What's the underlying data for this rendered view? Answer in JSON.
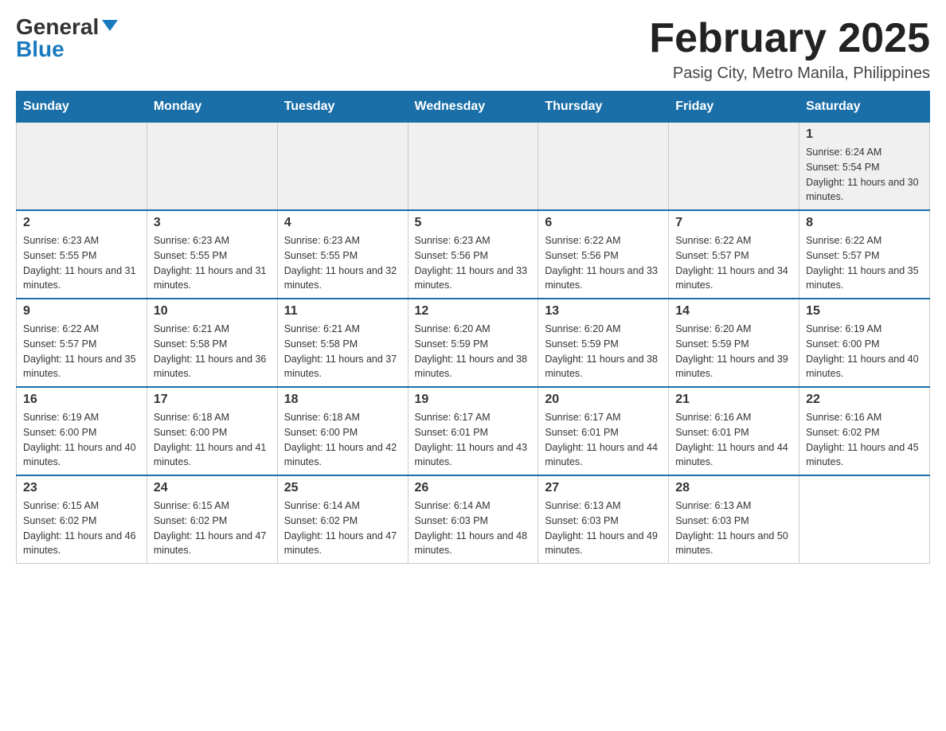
{
  "header": {
    "logo_general": "General",
    "logo_blue": "Blue",
    "month_title": "February 2025",
    "location": "Pasig City, Metro Manila, Philippines"
  },
  "days_of_week": [
    "Sunday",
    "Monday",
    "Tuesday",
    "Wednesday",
    "Thursday",
    "Friday",
    "Saturday"
  ],
  "weeks": [
    [
      {
        "day": "",
        "info": ""
      },
      {
        "day": "",
        "info": ""
      },
      {
        "day": "",
        "info": ""
      },
      {
        "day": "",
        "info": ""
      },
      {
        "day": "",
        "info": ""
      },
      {
        "day": "",
        "info": ""
      },
      {
        "day": "1",
        "info": "Sunrise: 6:24 AM\nSunset: 5:54 PM\nDaylight: 11 hours and 30 minutes."
      }
    ],
    [
      {
        "day": "2",
        "info": "Sunrise: 6:23 AM\nSunset: 5:55 PM\nDaylight: 11 hours and 31 minutes."
      },
      {
        "day": "3",
        "info": "Sunrise: 6:23 AM\nSunset: 5:55 PM\nDaylight: 11 hours and 31 minutes."
      },
      {
        "day": "4",
        "info": "Sunrise: 6:23 AM\nSunset: 5:55 PM\nDaylight: 11 hours and 32 minutes."
      },
      {
        "day": "5",
        "info": "Sunrise: 6:23 AM\nSunset: 5:56 PM\nDaylight: 11 hours and 33 minutes."
      },
      {
        "day": "6",
        "info": "Sunrise: 6:22 AM\nSunset: 5:56 PM\nDaylight: 11 hours and 33 minutes."
      },
      {
        "day": "7",
        "info": "Sunrise: 6:22 AM\nSunset: 5:57 PM\nDaylight: 11 hours and 34 minutes."
      },
      {
        "day": "8",
        "info": "Sunrise: 6:22 AM\nSunset: 5:57 PM\nDaylight: 11 hours and 35 minutes."
      }
    ],
    [
      {
        "day": "9",
        "info": "Sunrise: 6:22 AM\nSunset: 5:57 PM\nDaylight: 11 hours and 35 minutes."
      },
      {
        "day": "10",
        "info": "Sunrise: 6:21 AM\nSunset: 5:58 PM\nDaylight: 11 hours and 36 minutes."
      },
      {
        "day": "11",
        "info": "Sunrise: 6:21 AM\nSunset: 5:58 PM\nDaylight: 11 hours and 37 minutes."
      },
      {
        "day": "12",
        "info": "Sunrise: 6:20 AM\nSunset: 5:59 PM\nDaylight: 11 hours and 38 minutes."
      },
      {
        "day": "13",
        "info": "Sunrise: 6:20 AM\nSunset: 5:59 PM\nDaylight: 11 hours and 38 minutes."
      },
      {
        "day": "14",
        "info": "Sunrise: 6:20 AM\nSunset: 5:59 PM\nDaylight: 11 hours and 39 minutes."
      },
      {
        "day": "15",
        "info": "Sunrise: 6:19 AM\nSunset: 6:00 PM\nDaylight: 11 hours and 40 minutes."
      }
    ],
    [
      {
        "day": "16",
        "info": "Sunrise: 6:19 AM\nSunset: 6:00 PM\nDaylight: 11 hours and 40 minutes."
      },
      {
        "day": "17",
        "info": "Sunrise: 6:18 AM\nSunset: 6:00 PM\nDaylight: 11 hours and 41 minutes."
      },
      {
        "day": "18",
        "info": "Sunrise: 6:18 AM\nSunset: 6:00 PM\nDaylight: 11 hours and 42 minutes."
      },
      {
        "day": "19",
        "info": "Sunrise: 6:17 AM\nSunset: 6:01 PM\nDaylight: 11 hours and 43 minutes."
      },
      {
        "day": "20",
        "info": "Sunrise: 6:17 AM\nSunset: 6:01 PM\nDaylight: 11 hours and 44 minutes."
      },
      {
        "day": "21",
        "info": "Sunrise: 6:16 AM\nSunset: 6:01 PM\nDaylight: 11 hours and 44 minutes."
      },
      {
        "day": "22",
        "info": "Sunrise: 6:16 AM\nSunset: 6:02 PM\nDaylight: 11 hours and 45 minutes."
      }
    ],
    [
      {
        "day": "23",
        "info": "Sunrise: 6:15 AM\nSunset: 6:02 PM\nDaylight: 11 hours and 46 minutes."
      },
      {
        "day": "24",
        "info": "Sunrise: 6:15 AM\nSunset: 6:02 PM\nDaylight: 11 hours and 47 minutes."
      },
      {
        "day": "25",
        "info": "Sunrise: 6:14 AM\nSunset: 6:02 PM\nDaylight: 11 hours and 47 minutes."
      },
      {
        "day": "26",
        "info": "Sunrise: 6:14 AM\nSunset: 6:03 PM\nDaylight: 11 hours and 48 minutes."
      },
      {
        "day": "27",
        "info": "Sunrise: 6:13 AM\nSunset: 6:03 PM\nDaylight: 11 hours and 49 minutes."
      },
      {
        "day": "28",
        "info": "Sunrise: 6:13 AM\nSunset: 6:03 PM\nDaylight: 11 hours and 50 minutes."
      },
      {
        "day": "",
        "info": ""
      }
    ]
  ]
}
